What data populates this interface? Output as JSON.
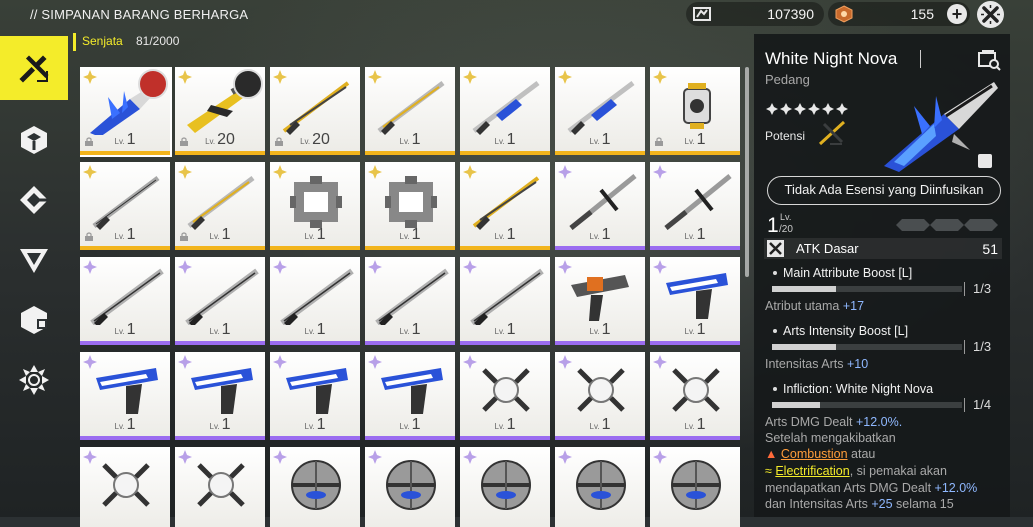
{
  "header": {
    "title": "// SIMPANAN BARANG BERHARGA",
    "currency_1": "107390",
    "currency_1_icon": "stock-bill-icon",
    "currency_2": "155",
    "currency_2_icon": "origeometry-icon",
    "add_label": "+"
  },
  "sidebar": {
    "items": [
      {
        "name": "weapon-tab",
        "icon": "weapon-icon",
        "active": true
      },
      {
        "name": "cube-tab",
        "icon": "cube-icon",
        "active": false
      },
      {
        "name": "gear-tab",
        "icon": "equipment-icon",
        "active": false
      },
      {
        "name": "triangle-tab",
        "icon": "triangle-icon",
        "active": false
      },
      {
        "name": "box-tab",
        "icon": "box-icon",
        "active": false
      },
      {
        "name": "flower-tab",
        "icon": "flower-icon",
        "active": false
      }
    ]
  },
  "category": {
    "label": "Senjata",
    "count": "81/2000"
  },
  "grid": {
    "level_prefix": "Lv.",
    "cards": [
      {
        "level": "1",
        "rarity": "gold",
        "art": "blue-sword",
        "avatar": "red",
        "lock": true,
        "selected": true
      },
      {
        "level": "20",
        "rarity": "gold",
        "art": "gold-gun",
        "avatar": "dark",
        "lock": true
      },
      {
        "level": "20",
        "rarity": "gold",
        "art": "gold-blade",
        "lock": true
      },
      {
        "level": "1",
        "rarity": "gold",
        "art": "silver-gold-blade",
        "lock": false
      },
      {
        "level": "1",
        "rarity": "gold",
        "art": "blue-silver-blade",
        "lock": false
      },
      {
        "level": "1",
        "rarity": "gold",
        "art": "blue-silver-blade",
        "lock": false
      },
      {
        "level": "1",
        "rarity": "gold",
        "art": "gold-lantern",
        "lock": true
      },
      {
        "level": "1",
        "rarity": "gold",
        "art": "silver-blade",
        "lock": true
      },
      {
        "level": "1",
        "rarity": "gold",
        "art": "silver-gold-blade",
        "lock": true
      },
      {
        "level": "1",
        "rarity": "gold",
        "art": "gear-ring",
        "lock": false
      },
      {
        "level": "1",
        "rarity": "gold",
        "art": "gear-ring",
        "lock": false
      },
      {
        "level": "1",
        "rarity": "gold",
        "art": "gold-blade",
        "lock": false
      },
      {
        "level": "1",
        "rarity": "purple",
        "art": "cross-sword",
        "lock": false
      },
      {
        "level": "1",
        "rarity": "purple",
        "art": "cross-sword",
        "lock": false
      },
      {
        "level": "1",
        "rarity": "purple",
        "art": "long-blade",
        "lock": false
      },
      {
        "level": "1",
        "rarity": "purple",
        "art": "long-blade",
        "lock": false
      },
      {
        "level": "1",
        "rarity": "purple",
        "art": "long-blade",
        "lock": false
      },
      {
        "level": "1",
        "rarity": "purple",
        "art": "long-blade",
        "lock": false
      },
      {
        "level": "1",
        "rarity": "purple",
        "art": "long-blade",
        "lock": false
      },
      {
        "level": "1",
        "rarity": "purple",
        "art": "orange-gun",
        "lock": false
      },
      {
        "level": "1",
        "rarity": "purple",
        "art": "blue-pistol",
        "lock": false
      },
      {
        "level": "1",
        "rarity": "purple",
        "art": "blue-pistol",
        "lock": false
      },
      {
        "level": "1",
        "rarity": "purple",
        "art": "blue-pistol",
        "lock": false
      },
      {
        "level": "1",
        "rarity": "purple",
        "art": "blue-pistol",
        "lock": false
      },
      {
        "level": "1",
        "rarity": "purple",
        "art": "blue-pistol",
        "lock": false
      },
      {
        "level": "1",
        "rarity": "purple",
        "art": "orb-claw",
        "lock": false
      },
      {
        "level": "1",
        "rarity": "purple",
        "art": "orb-claw",
        "lock": false
      },
      {
        "level": "1",
        "rarity": "purple",
        "art": "orb-claw",
        "lock": false
      },
      {
        "level": "",
        "rarity": "purple",
        "art": "orb-claw",
        "lock": false
      },
      {
        "level": "",
        "rarity": "purple",
        "art": "orb-claw",
        "lock": false
      },
      {
        "level": "",
        "rarity": "purple",
        "art": "metal-sphere",
        "lock": false
      },
      {
        "level": "",
        "rarity": "purple",
        "art": "metal-sphere",
        "lock": false
      },
      {
        "level": "",
        "rarity": "purple",
        "art": "metal-sphere",
        "lock": false
      },
      {
        "level": "",
        "rarity": "purple",
        "art": "metal-sphere",
        "lock": false
      },
      {
        "level": "",
        "rarity": "purple",
        "art": "metal-sphere",
        "lock": false
      }
    ]
  },
  "detail": {
    "name": "White Night Nova",
    "type": "Pedang",
    "stars": 6,
    "potential_label": "Potensi",
    "essence_button": "Tidak Ada Esensi yang Diinfusikan",
    "level": "1",
    "level_prefix": "Lv.",
    "level_max": "/20",
    "atk_label": "ATK Dasar",
    "atk_value": "51",
    "attributes": [
      {
        "title": "Main Attribute Boost [L]",
        "rank": "1/3",
        "desc": "Atribut utama ",
        "bonus": "+17"
      },
      {
        "title": "Arts Intensity Boost [L]",
        "rank": "1/3",
        "desc": "Intensitas Arts ",
        "bonus": "+10"
      },
      {
        "title": "Infliction: White Night Nova",
        "rank": "1/4",
        "desc": "Arts DMG Dealt ",
        "bonus": "+12.0%."
      }
    ],
    "desc_lines": {
      "l1": "Setelah mengakibatkan",
      "combustion": "Combustion",
      "atau": " atau",
      "electrification": "Electrification",
      "l3_rest": ", si pemakai akan",
      "l4": "mendapatkan Arts DMG Dealt ",
      "l4_bonus": "+12.0%",
      "l5": "dan Intensitas Arts ",
      "l5_bonus": "+25",
      "l5_rest": " selama 15"
    }
  },
  "colors": {
    "accent": "#f4ec2a",
    "gold_stripe": "#f2b41c",
    "purple_stripe": "#9b6cf0",
    "highlight_blue": "#8fb8ff"
  }
}
